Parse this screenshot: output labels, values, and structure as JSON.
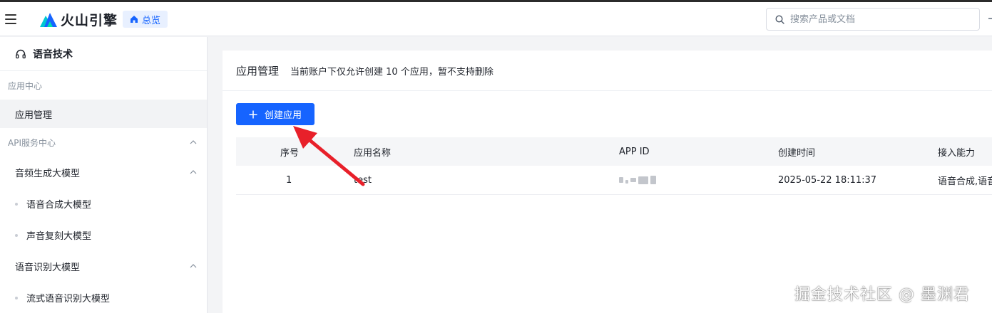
{
  "header": {
    "menu_icon": "hamburger-icon",
    "logo_text": "火山引擎",
    "home_tab_label": "总览",
    "search_placeholder": "搜索产品或文档"
  },
  "sidebar": {
    "product": "语音技术",
    "group_app_center": "应用中心",
    "app_manage": "应用管理",
    "group_api": "API服务中心",
    "sub_audio_gen": "音频生成大模型",
    "leaf_tts": "语音合成大模型",
    "leaf_clone": "声音复刻大模型",
    "sub_asr": "语音识别大模型",
    "leaf_stream_asr": "流式语音识别大模型"
  },
  "main": {
    "title": "应用管理",
    "subtitle": "当前账户下仅允许创建 10 个应用，暂不支持删除",
    "create_button": "创建应用",
    "columns": {
      "no": "序号",
      "name": "应用名称",
      "app_id": "APP ID",
      "created": "创建时间",
      "ability": "接入能力"
    },
    "rows": [
      {
        "no": "1",
        "name": "test",
        "created": "2025-05-22 18:11:37",
        "ability": "语音合成,语音"
      }
    ]
  },
  "colors": {
    "accent": "#1664ff",
    "annotation_arrow": "#e8202a"
  },
  "watermark": "掘金技术社区 @ 墨渊君"
}
